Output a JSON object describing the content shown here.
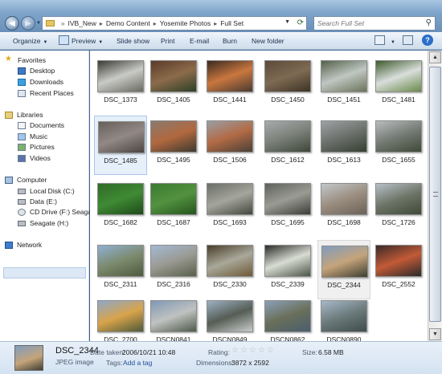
{
  "address_bar": {
    "crumbs": [
      "IVB_New",
      "Demo Content",
      "Yosemite Photos",
      "Full Set"
    ],
    "search_placeholder": "Search Full Set"
  },
  "toolbar": {
    "organize": "Organize",
    "preview": "Preview",
    "slideshow": "Slide show",
    "print": "Print",
    "email": "E-mail",
    "burn": "Burn",
    "new_folder": "New folder",
    "help": "?"
  },
  "nav": {
    "favorites": "Favorites",
    "desktop": "Desktop",
    "downloads": "Downloads",
    "recent": "Recent Places",
    "libraries": "Libraries",
    "documents": "Documents",
    "music": "Music",
    "pictures": "Pictures",
    "videos": "Videos",
    "computer": "Computer",
    "local_disk": "Local Disk (C:)",
    "data_disk": "Data (E:)",
    "cd_drive": "CD Drive (F:) Seagate",
    "seagate": "Seagate (H:)",
    "network": "Network"
  },
  "files": [
    {
      "name": "DSC_1373",
      "colors": [
        "#3b3a35",
        "#c9cbc6",
        "#6a6a62"
      ]
    },
    {
      "name": "DSC_1405",
      "colors": [
        "#5b3a2a",
        "#8c6b4a",
        "#2e3f28"
      ]
    },
    {
      "name": "DSC_1441",
      "colors": [
        "#3a2a22",
        "#c9773e",
        "#4a3b32"
      ]
    },
    {
      "name": "DSC_1450",
      "colors": [
        "#5c4a3a",
        "#7d6a52",
        "#3e3326"
      ]
    },
    {
      "name": "DSC_1451",
      "colors": [
        "#54614a",
        "#bfc7c2",
        "#6b7459"
      ]
    },
    {
      "name": "DSC_1481",
      "colors": [
        "#3e5a2d",
        "#d9dedb",
        "#6a8a4a"
      ]
    },
    {
      "name": "DSC_1485",
      "colors": [
        "#675f5a",
        "#928986",
        "#4c4540"
      ]
    },
    {
      "name": "DSC_1495",
      "colors": [
        "#8a7a6e",
        "#b1683e",
        "#3d3a31"
      ]
    },
    {
      "name": "DSC_1506",
      "colors": [
        "#9a9ea4",
        "#b26a45",
        "#4a4137"
      ]
    },
    {
      "name": "DSC_1612",
      "colors": [
        "#a8acae",
        "#7b8078",
        "#3d4739"
      ]
    },
    {
      "name": "DSC_1613",
      "colors": [
        "#9da2a3",
        "#6c706c",
        "#364031"
      ]
    },
    {
      "name": "DSC_1655",
      "colors": [
        "#b9bcbe",
        "#747a74",
        "#3e4a36"
      ]
    },
    {
      "name": "DSC_1682",
      "colors": [
        "#2f6b28",
        "#3f8a34",
        "#1e4a1a"
      ]
    },
    {
      "name": "DSC_1687",
      "colors": [
        "#3a7a30",
        "#52923f",
        "#24541d"
      ]
    },
    {
      "name": "DSC_1693",
      "colors": [
        "#6b6e66",
        "#a4a69c",
        "#44473f"
      ]
    },
    {
      "name": "DSC_1695",
      "colors": [
        "#5f625c",
        "#9a9c94",
        "#3b3d37"
      ]
    },
    {
      "name": "DSC_1698",
      "colors": [
        "#c2c7cc",
        "#9b8e80",
        "#6b6257"
      ]
    },
    {
      "name": "DSC_1726",
      "colors": [
        "#b7c0c8",
        "#6e7568",
        "#3e4a36"
      ]
    },
    {
      "name": "DSC_2311",
      "colors": [
        "#8fb0d2",
        "#7c8a6e",
        "#4e5a3e"
      ]
    },
    {
      "name": "DSC_2316",
      "colors": [
        "#a3b9d4",
        "#9a9a92",
        "#59604b"
      ]
    },
    {
      "name": "DSC_2330",
      "colors": [
        "#4a3d2a",
        "#a9a89a",
        "#6e5a36"
      ]
    },
    {
      "name": "DSC_2339",
      "colors": [
        "#2a2d28",
        "#d8dcd2",
        "#4c5547"
      ]
    },
    {
      "name": "DSC_2344",
      "colors": [
        "#7f9cbf",
        "#c5a47a",
        "#3e3f33"
      ]
    },
    {
      "name": "DSC_2552",
      "colors": [
        "#3a2a2a",
        "#c25a36",
        "#2b2a2a"
      ]
    },
    {
      "name": "DSC_2700",
      "colors": [
        "#8ea8c9",
        "#d9a34a",
        "#4d5a3a"
      ]
    },
    {
      "name": "DSCN0841",
      "colors": [
        "#7f98b5",
        "#c0c2c0",
        "#4e5a49"
      ]
    },
    {
      "name": "DSCN0849",
      "colors": [
        "#9db0c2",
        "#555d55",
        "#c8cccb"
      ]
    },
    {
      "name": "DSCN0862",
      "colors": [
        "#8aa0b8",
        "#6a6f5a",
        "#4a5e6e"
      ]
    },
    {
      "name": "DSCN0890",
      "colors": [
        "#a7b8c9",
        "#6b7a7a",
        "#3e4d4a"
      ]
    }
  ],
  "selected_index": 6,
  "hover_index": 22,
  "details": {
    "name": "DSC_2344",
    "type": "JPEG image",
    "date_taken_label": "Date taken:",
    "date_taken": "2006/10/21 10:48",
    "tags_label": "Tags:",
    "tags_value": "Add a tag",
    "rating_label": "Rating:",
    "rating": 0,
    "dimensions_label": "Dimensions:",
    "dimensions": "3872 x 2592",
    "size_label": "Size:",
    "size": "6.58 MB"
  }
}
